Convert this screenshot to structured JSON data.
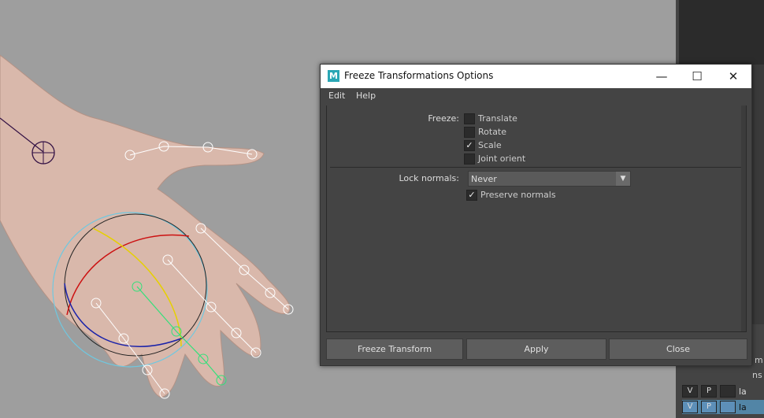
{
  "dialog": {
    "title": "Freeze Transformations Options",
    "icon": "maya-app-icon",
    "menus": [
      "Edit",
      "Help"
    ],
    "freeze_label": "Freeze:",
    "options": [
      {
        "label": "Translate",
        "checked": false
      },
      {
        "label": "Rotate",
        "checked": false
      },
      {
        "label": "Scale",
        "checked": true
      },
      {
        "label": "Joint orient",
        "checked": false
      }
    ],
    "lock_normals_label": "Lock normals:",
    "lock_normals_value": "Never",
    "preserve_normals_label": "Preserve normals",
    "preserve_normals_checked": true,
    "buttons": {
      "freeze": "Freeze Transform",
      "apply": "Apply",
      "close": "Close"
    },
    "window_controls": {
      "minimize": "—",
      "maximize": "☐",
      "close": "✕"
    }
  },
  "side_panel": {
    "partial_text_1": "m",
    "partial_text_2": "ns",
    "layer_rows": [
      {
        "v": "V",
        "p": "P",
        "name": "la"
      },
      {
        "v": "V",
        "p": "P",
        "name": "la"
      }
    ]
  }
}
